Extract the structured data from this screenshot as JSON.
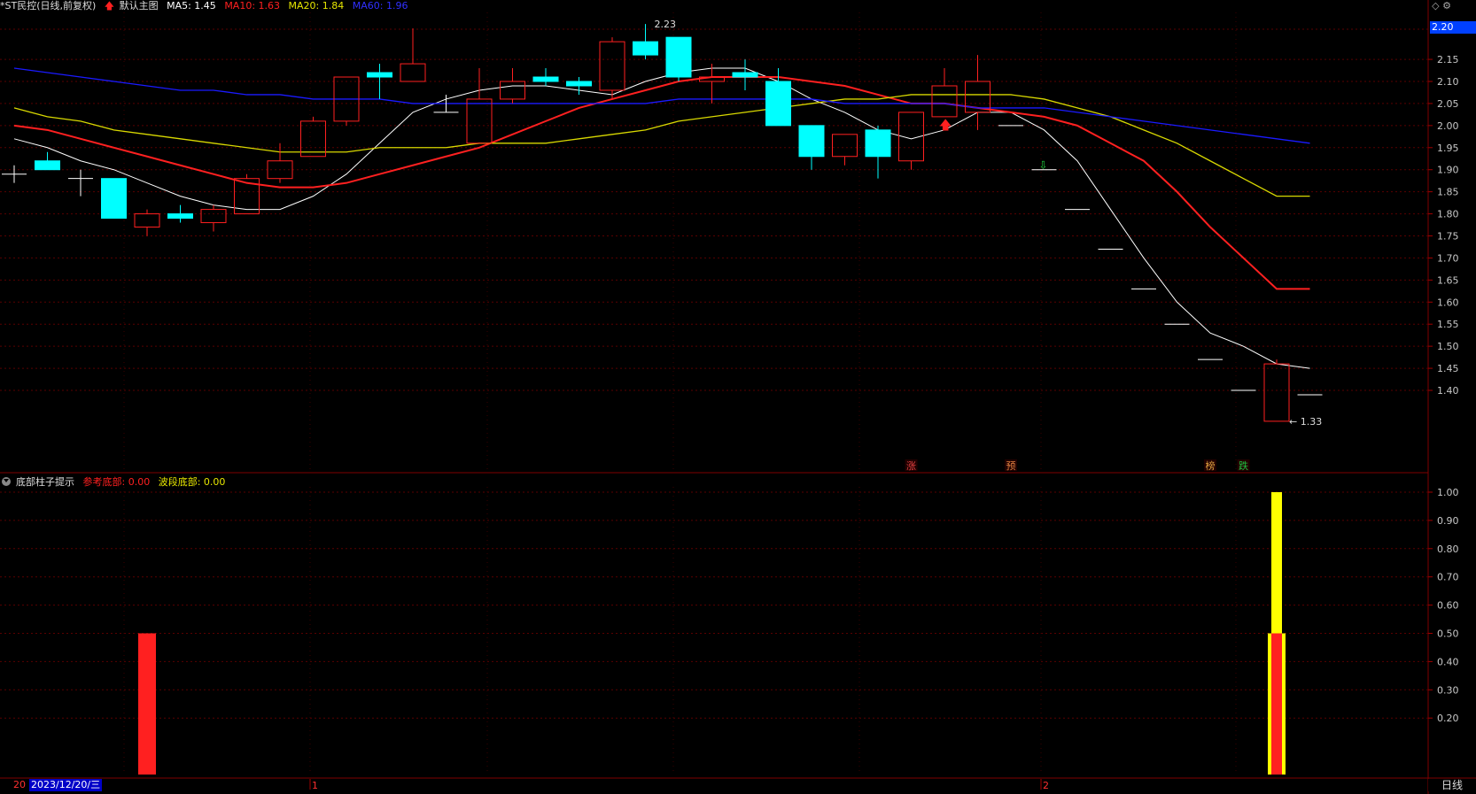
{
  "header": {
    "symbol": "*ST民控(日线,前复权)",
    "main_template": "默认主图",
    "ma5": "MA5: 1.45",
    "ma10": "MA10: 1.63",
    "ma20": "MA20: 1.84",
    "ma60": "MA60: 1.96",
    "colors": {
      "ma5": "#ffffff",
      "ma10": "#ff2020",
      "ma20": "#e6e600",
      "ma60": "#2020ff"
    }
  },
  "indicator": {
    "name": "底部柱子提示",
    "ref_bottom": "参考底部: 0.00",
    "wave_bottom": "波段底部: 0.00"
  },
  "chart_data": [
    {
      "type": "candlestick",
      "y_ticks": [
        "2.15",
        "2.10",
        "2.05",
        "2.00",
        "1.95",
        "1.90",
        "1.85",
        "1.80",
        "1.75",
        "1.70",
        "1.65",
        "1.60",
        "1.55",
        "1.50",
        "1.45",
        "1.40"
      ],
      "current_price_tag": "2.20",
      "high_label": "2.23",
      "low_label": "1.33",
      "candles": [
        {
          "o": 1.89,
          "h": 1.91,
          "l": 1.87,
          "c": 1.89
        },
        {
          "o": 1.92,
          "h": 1.94,
          "l": 1.9,
          "c": 1.9
        },
        {
          "o": 1.88,
          "h": 1.9,
          "l": 1.84,
          "c": 1.88
        },
        {
          "o": 1.88,
          "h": 1.88,
          "l": 1.79,
          "c": 1.79
        },
        {
          "o": 1.77,
          "h": 1.81,
          "l": 1.75,
          "c": 1.8
        },
        {
          "o": 1.8,
          "h": 1.82,
          "l": 1.78,
          "c": 1.79
        },
        {
          "o": 1.78,
          "h": 1.82,
          "l": 1.76,
          "c": 1.81
        },
        {
          "o": 1.8,
          "h": 1.89,
          "l": 1.8,
          "c": 1.88
        },
        {
          "o": 1.88,
          "h": 1.96,
          "l": 1.87,
          "c": 1.92
        },
        {
          "o": 1.93,
          "h": 2.02,
          "l": 1.93,
          "c": 2.01
        },
        {
          "o": 2.01,
          "h": 2.11,
          "l": 2.0,
          "c": 2.11
        },
        {
          "o": 2.12,
          "h": 2.14,
          "l": 2.06,
          "c": 2.11
        },
        {
          "o": 2.1,
          "h": 2.22,
          "l": 2.1,
          "c": 2.14
        },
        {
          "o": 2.03,
          "h": 2.07,
          "l": 2.03,
          "c": 2.03
        },
        {
          "o": 1.96,
          "h": 2.13,
          "l": 1.96,
          "c": 2.06
        },
        {
          "o": 2.06,
          "h": 2.13,
          "l": 2.05,
          "c": 2.1
        },
        {
          "o": 2.11,
          "h": 2.13,
          "l": 2.09,
          "c": 2.1
        },
        {
          "o": 2.1,
          "h": 2.11,
          "l": 2.07,
          "c": 2.09
        },
        {
          "o": 2.08,
          "h": 2.2,
          "l": 2.06,
          "c": 2.19
        },
        {
          "o": 2.19,
          "h": 2.23,
          "l": 2.15,
          "c": 2.16
        },
        {
          "o": 2.2,
          "h": 2.2,
          "l": 2.1,
          "c": 2.11
        },
        {
          "o": 2.1,
          "h": 2.14,
          "l": 2.05,
          "c": 2.11
        },
        {
          "o": 2.12,
          "h": 2.15,
          "l": 2.08,
          "c": 2.11
        },
        {
          "o": 2.1,
          "h": 2.13,
          "l": 2.0,
          "c": 2.0
        },
        {
          "o": 2.0,
          "h": 2.0,
          "l": 1.9,
          "c": 1.93
        },
        {
          "o": 1.93,
          "h": 1.98,
          "l": 1.91,
          "c": 1.98
        },
        {
          "o": 1.99,
          "h": 2.0,
          "l": 1.88,
          "c": 1.93
        },
        {
          "o": 1.92,
          "h": 2.03,
          "l": 1.9,
          "c": 2.03
        },
        {
          "o": 2.02,
          "h": 2.13,
          "l": 2.02,
          "c": 2.09
        },
        {
          "o": 2.03,
          "h": 2.16,
          "l": 1.99,
          "c": 2.1
        },
        {
          "o": 2.0,
          "h": 2.0,
          "l": 2.0,
          "c": 2.0
        },
        {
          "o": 1.9,
          "h": 1.9,
          "l": 1.9,
          "c": 1.9
        },
        {
          "o": 1.81,
          "h": 1.81,
          "l": 1.81,
          "c": 1.81
        },
        {
          "o": 1.72,
          "h": 1.72,
          "l": 1.72,
          "c": 1.72
        },
        {
          "o": 1.63,
          "h": 1.63,
          "l": 1.63,
          "c": 1.63
        },
        {
          "o": 1.55,
          "h": 1.55,
          "l": 1.55,
          "c": 1.55
        },
        {
          "o": 1.47,
          "h": 1.47,
          "l": 1.47,
          "c": 1.47
        },
        {
          "o": 1.4,
          "h": 1.4,
          "l": 1.4,
          "c": 1.4
        },
        {
          "o": 1.33,
          "h": 1.47,
          "l": 1.33,
          "c": 1.46
        },
        {
          "o": 1.39,
          "h": 1.39,
          "l": 1.39,
          "c": 1.39
        }
      ],
      "series": [
        {
          "name": "MA5",
          "values": [
            1.97,
            1.95,
            1.92,
            1.9,
            1.87,
            1.84,
            1.82,
            1.81,
            1.81,
            1.84,
            1.89,
            1.96,
            2.03,
            2.06,
            2.08,
            2.09,
            2.09,
            2.08,
            2.07,
            2.1,
            2.12,
            2.13,
            2.13,
            2.1,
            2.06,
            2.03,
            1.99,
            1.97,
            1.99,
            2.03,
            2.03,
            1.99,
            1.92,
            1.81,
            1.7,
            1.6,
            1.53,
            1.5,
            1.46,
            1.45
          ]
        },
        {
          "name": "MA10",
          "values": [
            2.0,
            1.99,
            1.97,
            1.95,
            1.93,
            1.91,
            1.89,
            1.87,
            1.86,
            1.86,
            1.87,
            1.89,
            1.91,
            1.93,
            1.95,
            1.98,
            2.01,
            2.04,
            2.06,
            2.08,
            2.1,
            2.11,
            2.11,
            2.11,
            2.1,
            2.09,
            2.07,
            2.05,
            2.05,
            2.04,
            2.03,
            2.02,
            2.0,
            1.96,
            1.92,
            1.85,
            1.77,
            1.7,
            1.63,
            1.63
          ]
        },
        {
          "name": "MA20",
          "values": [
            2.04,
            2.02,
            2.01,
            1.99,
            1.98,
            1.97,
            1.96,
            1.95,
            1.94,
            1.94,
            1.94,
            1.95,
            1.95,
            1.95,
            1.96,
            1.96,
            1.96,
            1.97,
            1.98,
            1.99,
            2.01,
            2.02,
            2.03,
            2.04,
            2.05,
            2.06,
            2.06,
            2.07,
            2.07,
            2.07,
            2.07,
            2.06,
            2.04,
            2.02,
            1.99,
            1.96,
            1.92,
            1.88,
            1.84,
            1.84
          ]
        },
        {
          "name": "MA60",
          "values": [
            2.13,
            2.12,
            2.11,
            2.1,
            2.09,
            2.08,
            2.08,
            2.07,
            2.07,
            2.06,
            2.06,
            2.06,
            2.05,
            2.05,
            2.05,
            2.05,
            2.05,
            2.05,
            2.05,
            2.05,
            2.06,
            2.06,
            2.06,
            2.06,
            2.06,
            2.05,
            2.05,
            2.05,
            2.05,
            2.04,
            2.04,
            2.04,
            2.03,
            2.02,
            2.01,
            2.0,
            1.99,
            1.98,
            1.97,
            1.96
          ]
        }
      ],
      "markers": [
        {
          "text": "涨",
          "color": "#e04040"
        },
        {
          "text": "预",
          "color": "#e08040"
        },
        {
          "text": "榜",
          "color": "#e0a040"
        },
        {
          "text": "跌",
          "color": "#20c040"
        }
      ]
    },
    {
      "type": "bar",
      "y_ticks": [
        "1.00",
        "0.90",
        "0.80",
        "0.70",
        "0.60",
        "0.50",
        "0.40",
        "0.30",
        "0.20"
      ],
      "ylim": [
        0,
        1.05
      ],
      "series": [
        {
          "name": "参考底部",
          "values": [
            0,
            0,
            0,
            0,
            0.5,
            0,
            0,
            0,
            0,
            0,
            0,
            0,
            0,
            0,
            0,
            0,
            0,
            0,
            0,
            0,
            0,
            0,
            0,
            0,
            0,
            0,
            0,
            0,
            0,
            0,
            0,
            0,
            0,
            0,
            0,
            0,
            0,
            0,
            0.5,
            0
          ],
          "color": "#ff2020"
        },
        {
          "name": "波段底部",
          "values": [
            0,
            0,
            0,
            0,
            0,
            0,
            0,
            0,
            0,
            0,
            0,
            0,
            0,
            0,
            0,
            0,
            0,
            0,
            0,
            0,
            0,
            0,
            0,
            0,
            0,
            0,
            0,
            0,
            0,
            0,
            0,
            0,
            0,
            0,
            0,
            0,
            0,
            0,
            1.0,
            0
          ],
          "color": "#ffff00"
        }
      ]
    }
  ],
  "x_axis": {
    "left_label": "20",
    "selected_date": "2023/12/20/三",
    "month_marks": [
      "1",
      "2"
    ]
  },
  "period": "日线"
}
